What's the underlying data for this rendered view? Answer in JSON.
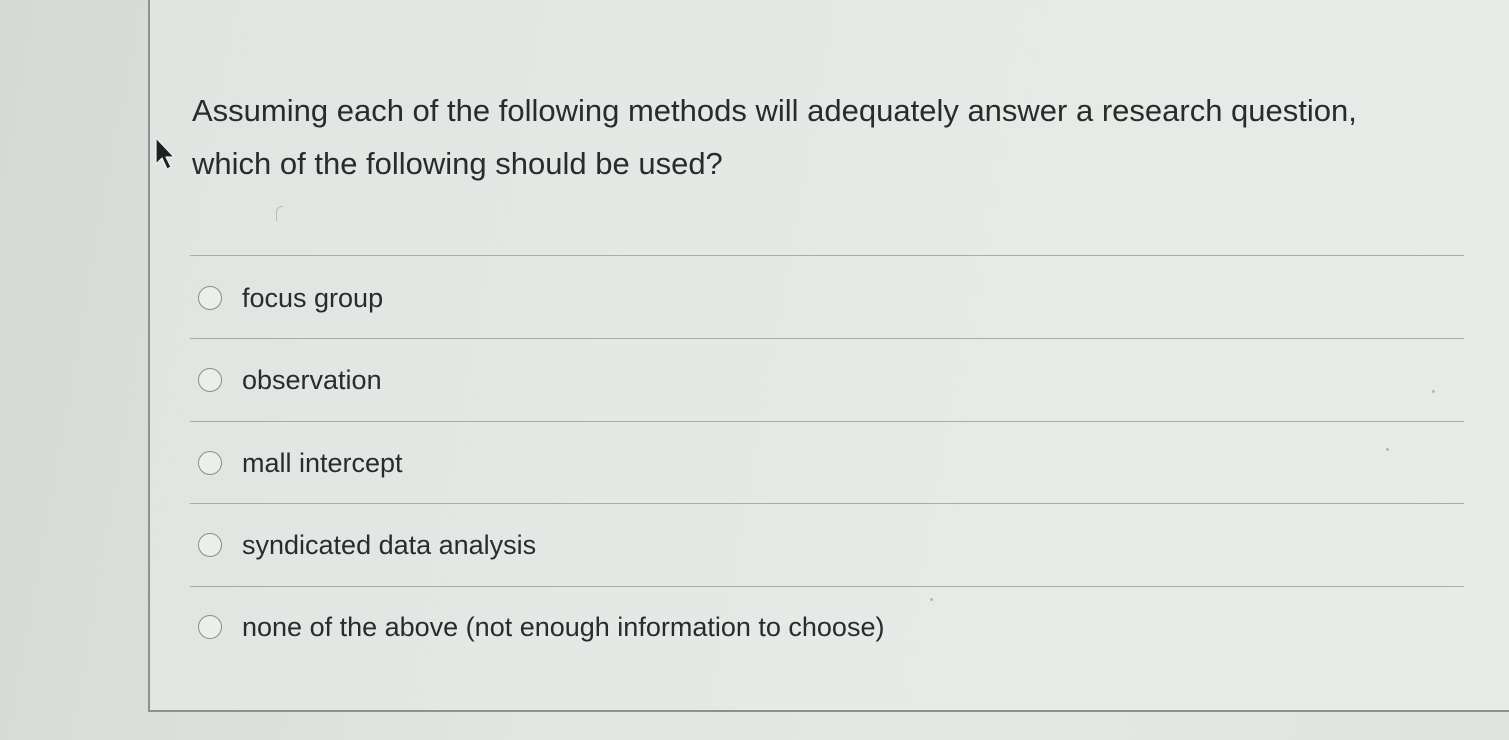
{
  "question": {
    "line1": "Assuming each of the following methods will adequately answer a research question,",
    "line2": "which of the following should be used?"
  },
  "options": [
    {
      "label": "focus group",
      "selected": false
    },
    {
      "label": "observation",
      "selected": false
    },
    {
      "label": "mall intercept",
      "selected": false
    },
    {
      "label": "syndicated data analysis",
      "selected": false
    },
    {
      "label": "none of the above (not enough information to choose)",
      "selected": false
    }
  ],
  "icons": {
    "cursor": "mouse-pointer-arrow",
    "radio": "radio-button-unchecked"
  },
  "colors": {
    "text": "#2a2b2e",
    "divider": "#a9aca9",
    "card_border": "#8e918e"
  }
}
